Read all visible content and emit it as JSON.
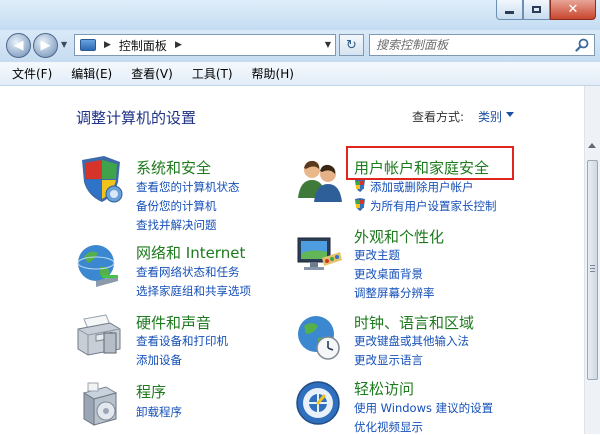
{
  "window": {
    "min_icon": "minimize-icon",
    "max_icon": "maximize-icon",
    "close_glyph": "✕"
  },
  "nav": {
    "back_glyph": "◀",
    "forward_glyph": "▶",
    "address_crumb": "控制面板",
    "refresh_glyph": "↻",
    "search_placeholder": "搜索控制面板"
  },
  "menu": {
    "items": [
      "文件(F)",
      "编辑(E)",
      "查看(V)",
      "工具(T)",
      "帮助(H)"
    ]
  },
  "header": {
    "title": "调整计算机的设置",
    "view_label": "查看方式:",
    "view_value": "类别"
  },
  "categories": [
    {
      "title": "系统和安全",
      "icon": "security-shield-icon",
      "links": [
        "查看您的计算机状态",
        "备份您的计算机",
        "查找并解决问题"
      ]
    },
    {
      "title": "网络和 Internet",
      "icon": "network-globe-icon",
      "links": [
        "查看网络状态和任务",
        "选择家庭组和共享选项"
      ]
    },
    {
      "title": "硬件和声音",
      "icon": "printer-icon",
      "links": [
        "查看设备和打印机",
        "添加设备"
      ]
    },
    {
      "title": "程序",
      "icon": "programs-box-icon",
      "links": [
        "卸载程序"
      ]
    },
    {
      "title": "用户帐户和家庭安全",
      "icon": "users-icon",
      "links": [
        "添加或删除用户帐户",
        "为所有用户设置家长控制"
      ]
    },
    {
      "title": "外观和个性化",
      "icon": "monitor-palette-icon",
      "links": [
        "更改主题",
        "更改桌面背景",
        "调整屏幕分辨率"
      ]
    },
    {
      "title": "时钟、语言和区域",
      "icon": "globe-clock-icon",
      "links": [
        "更改键盘或其他输入法",
        "更改显示语言"
      ]
    },
    {
      "title": "轻松访问",
      "icon": "ease-of-access-icon",
      "links": [
        "使用 Windows 建议的设置",
        "优化视频显示"
      ]
    }
  ],
  "colors": {
    "category_title": "#1d7a1d",
    "link": "#1550b8",
    "page_title": "#1e3287",
    "highlight": "#e0261c"
  }
}
